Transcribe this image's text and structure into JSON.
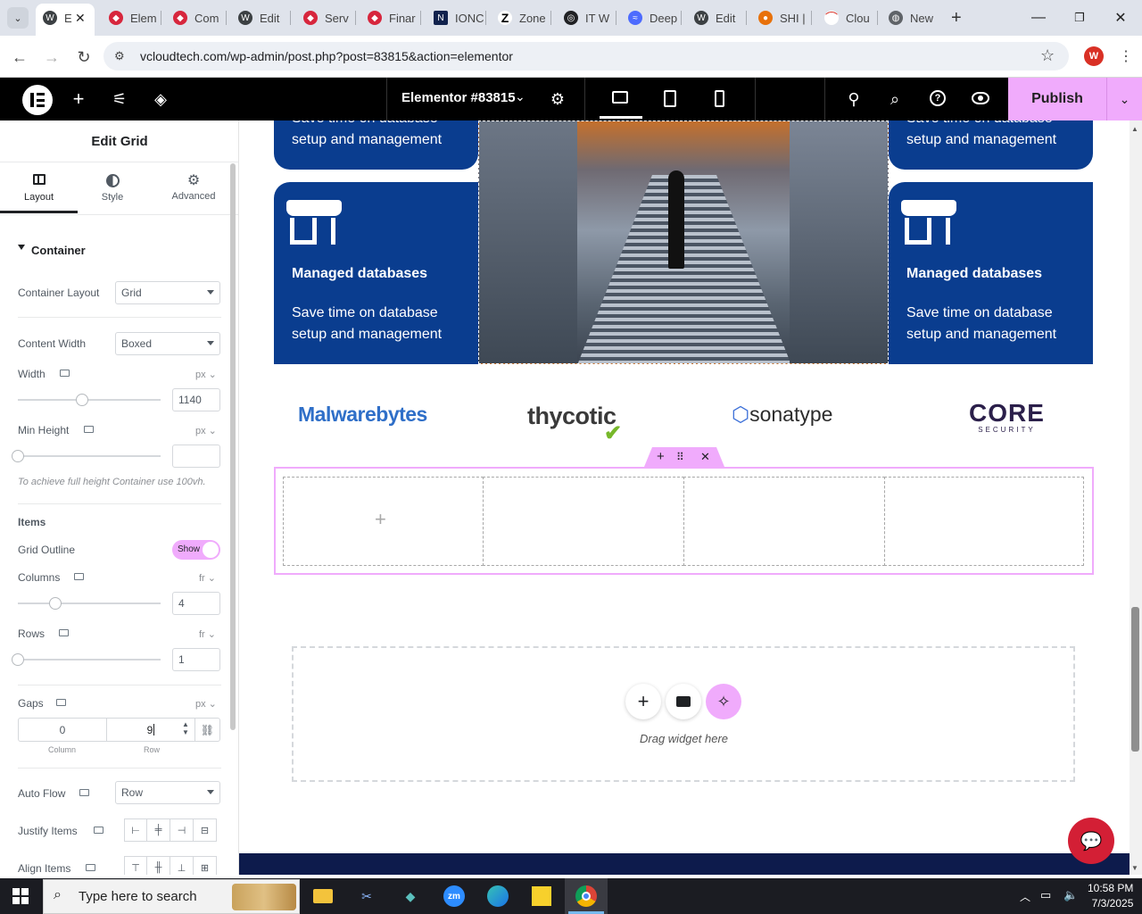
{
  "browser": {
    "tabs": [
      {
        "label": "E",
        "icon": "elementor-icon",
        "color": "#0a58ca"
      },
      {
        "label": "Elem",
        "icon": "elementor-red-icon",
        "color": "#d7263d"
      },
      {
        "label": "Com",
        "icon": "elementor-red-icon",
        "color": "#d7263d"
      },
      {
        "label": "Edit",
        "icon": "wordpress-icon",
        "color": "#3c4043"
      },
      {
        "label": "Serv",
        "icon": "elementor-red-icon",
        "color": "#d7263d"
      },
      {
        "label": "Finar",
        "icon": "elementor-red-icon",
        "color": "#d7263d"
      },
      {
        "label": "IONC",
        "icon": "ionos-icon",
        "color": "#11224d"
      },
      {
        "label": "Zone",
        "icon": "zone-icon",
        "color": "#000000"
      },
      {
        "label": "IT W",
        "icon": "openai-icon",
        "color": "#202124"
      },
      {
        "label": "Deep",
        "icon": "deepseek-icon",
        "color": "#4d6bfe"
      },
      {
        "label": "Edit",
        "icon": "wordpress-icon",
        "color": "#3c4043"
      },
      {
        "label": "SHI |",
        "icon": "chrome-circle-icon",
        "color": "#e8710a"
      },
      {
        "label": "Clou",
        "icon": "cloud-red-icon",
        "color": "#d93025"
      },
      {
        "label": "New",
        "icon": "chrome-new-icon",
        "color": "#5f6368"
      }
    ],
    "url": "vcloudtech.com/wp-admin/post.php?post=83815&action=elementor",
    "profile_initial": "W"
  },
  "topbar": {
    "doc_title": "Elementor #83815",
    "publish_label": "Publish"
  },
  "panel": {
    "title": "Edit Grid",
    "tabs": [
      {
        "label": "Layout",
        "icon": "layout-icon"
      },
      {
        "label": "Style",
        "icon": "half-circle-icon"
      },
      {
        "label": "Advanced",
        "icon": "gear-icon"
      }
    ],
    "section_title": "Container",
    "container_layout": {
      "label": "Container Layout",
      "value": "Grid"
    },
    "content_width": {
      "label": "Content Width",
      "value": "Boxed"
    },
    "width": {
      "label": "Width",
      "unit": "px",
      "value": "1140",
      "level": 0.45
    },
    "min_height": {
      "label": "Min Height",
      "unit": "px",
      "value": "",
      "level": 0.0
    },
    "min_height_hint": "To achieve full height Container use 100vh.",
    "items_heading": "Items",
    "grid_outline": {
      "label": "Grid Outline",
      "value": "Show"
    },
    "columns": {
      "label": "Columns",
      "unit": "fr",
      "value": "4",
      "level": 0.26
    },
    "rows": {
      "label": "Rows",
      "unit": "fr",
      "value": "1",
      "level": 0.0
    },
    "gaps": {
      "label": "Gaps",
      "unit": "px",
      "column": "0",
      "row": "9",
      "column_label": "Column",
      "row_label": "Row"
    },
    "auto_flow": {
      "label": "Auto Flow",
      "value": "Row"
    },
    "justify_items": {
      "label": "Justify Items"
    },
    "align_items": {
      "label": "Align Items"
    }
  },
  "canvas": {
    "cards": {
      "partial_text": "setup and management",
      "partial_text_top": "Save time on database",
      "title": "Managed databases",
      "text_line1": "Save time on database",
      "text_line2": "setup and management"
    },
    "logos": [
      "Malwarebytes",
      "thycotic",
      "sonatype",
      "CORE"
    ],
    "core_sub": "SECURITY",
    "drop_text": "Drag widget here"
  },
  "taskbar": {
    "search_placeholder": "Type here to search",
    "time": "10:58 PM",
    "date": "7/3/2025"
  }
}
